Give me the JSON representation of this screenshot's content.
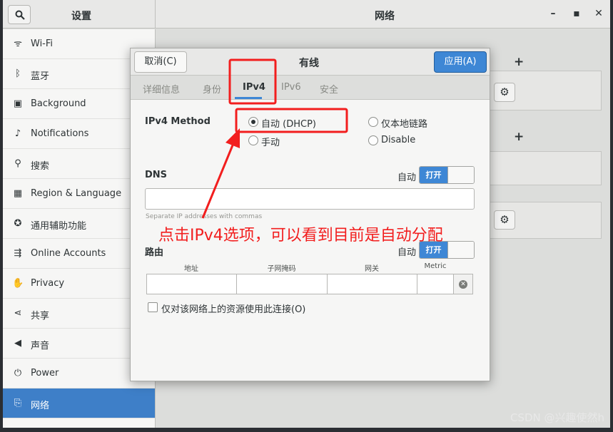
{
  "settings": {
    "sidebar_title": "设置",
    "panel_title": "网络",
    "items": [
      {
        "icon": "wifi-icon",
        "glyph": "ᯤ",
        "label": "Wi-Fi"
      },
      {
        "icon": "bluetooth-icon",
        "glyph": "ᛒ",
        "label": "蓝牙"
      },
      {
        "icon": "background-icon",
        "glyph": "▣",
        "label": "Background"
      },
      {
        "icon": "bell-icon",
        "glyph": "🔔",
        "label": "Notifications"
      },
      {
        "icon": "search-icon",
        "glyph": "⚲",
        "label": "搜索"
      },
      {
        "icon": "region-icon",
        "glyph": "▦",
        "label": "Region & Language"
      },
      {
        "icon": "accessibility-icon",
        "glyph": "♿",
        "label": "通用辅助功能"
      },
      {
        "icon": "online-accounts-icon",
        "glyph": "⇶",
        "label": "Online Accounts"
      },
      {
        "icon": "hand-icon",
        "glyph": "✋",
        "label": "Privacy"
      },
      {
        "icon": "share-icon",
        "glyph": "⋖",
        "label": "共享"
      },
      {
        "icon": "speaker-icon",
        "glyph": "🔉",
        "label": "声音"
      },
      {
        "icon": "power-icon",
        "glyph": "⏻",
        "label": "Power"
      },
      {
        "icon": "network-icon",
        "glyph": "⎘",
        "label": "网络",
        "active": true
      }
    ]
  },
  "dialog": {
    "title": "有线",
    "cancel_label": "取消(C)",
    "apply_label": "应用(A)",
    "tabs": [
      {
        "label": "详细信息",
        "active": false
      },
      {
        "label": "身份",
        "active": false
      },
      {
        "label": "IPv4",
        "active": true
      },
      {
        "label": "IPv6",
        "active": false
      },
      {
        "label": "安全",
        "active": false
      }
    ],
    "ipv4_method_label": "IPv4 Method",
    "methods": [
      {
        "label": "自动 (DHCP)",
        "selected": true
      },
      {
        "label": "仅本地链路",
        "selected": false
      },
      {
        "label": "手动",
        "selected": false
      },
      {
        "label": "Disable",
        "selected": false
      }
    ],
    "dns": {
      "label": "DNS",
      "auto_label": "自动",
      "switch_on_label": "打开",
      "value": "",
      "hint": "Separate IP addresses with commas"
    },
    "routes": {
      "label": "路由",
      "auto_label": "自动",
      "switch_on_label": "打开",
      "columns": [
        "地址",
        "子网掩码",
        "网关",
        "Metric"
      ],
      "values": [
        "",
        "",
        "",
        ""
      ]
    },
    "only_local_label": "仅对该网络上的资源使用此连接(O)"
  },
  "annotation": {
    "text": "点击IPv4选项，可以看到目前是自动分配",
    "color": "#f21e1e"
  },
  "watermark": "CSDN @兴趣使然h"
}
